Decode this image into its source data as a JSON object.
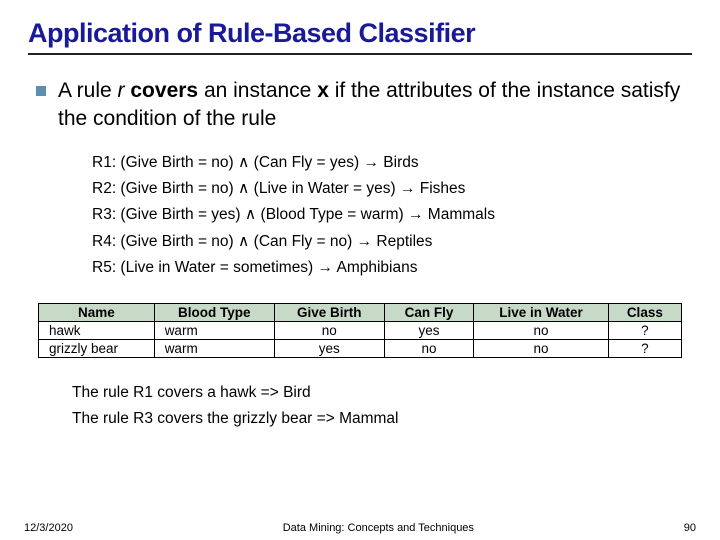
{
  "title": "Application of Rule-Based Classifier",
  "bullet": {
    "pre": "A rule ",
    "r": "r",
    "covers": " covers",
    "mid": " an instance ",
    "x": "x",
    "post": " if the attributes of the instance satisfy the condition of the rule"
  },
  "rules": [
    "R1: (Give Birth = no) ∧ (Can Fly = yes) → Birds",
    "R2: (Give Birth = no) ∧ (Live in Water = yes) → Fishes",
    "R3: (Give Birth = yes) ∧ (Blood Type = warm) → Mammals",
    "R4: (Give Birth = no) ∧ (Can Fly = no) → Reptiles",
    "R5: (Live in Water = sometimes) → Amphibians"
  ],
  "table": {
    "headers": [
      "Name",
      "Blood Type",
      "Give Birth",
      "Can Fly",
      "Live in Water",
      "Class"
    ],
    "rows": [
      {
        "name": "hawk",
        "blood": "warm",
        "birth": "no",
        "fly": "yes",
        "water": "no",
        "class": "?"
      },
      {
        "name": "grizzly bear",
        "blood": "warm",
        "birth": "yes",
        "fly": "no",
        "water": "no",
        "class": "?"
      }
    ]
  },
  "conclusions": [
    "The rule R1 covers a hawk => Bird",
    "The rule R3 covers the grizzly bear => Mammal"
  ],
  "footer": {
    "date": "12/3/2020",
    "source": "Data Mining: Concepts and Techniques",
    "page": "90"
  }
}
